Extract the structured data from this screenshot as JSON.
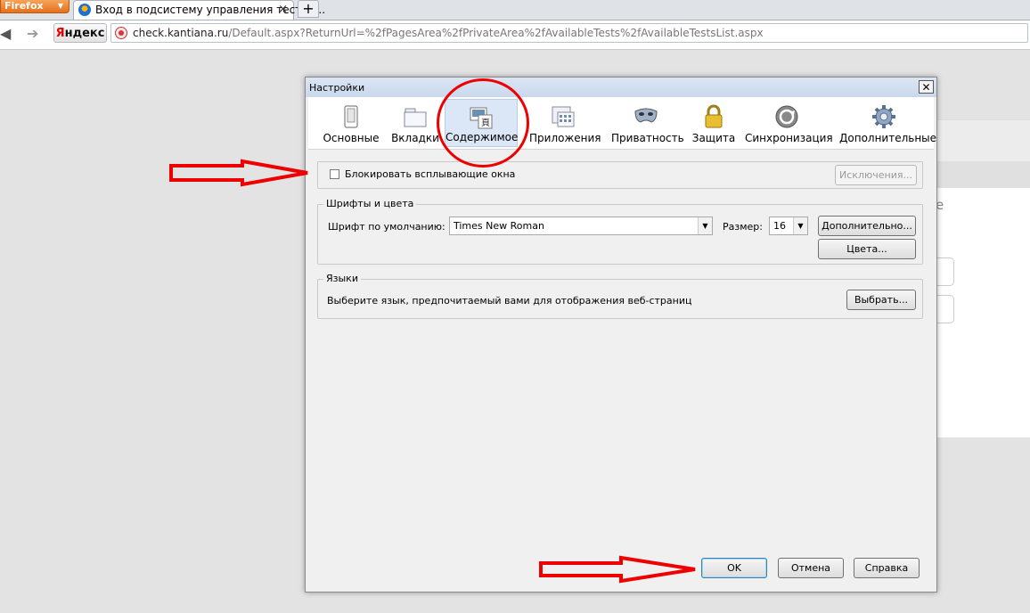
{
  "browser": {
    "menu_button": "Firefox",
    "tab_title": "Вход в подсистему управления тестир...",
    "tab_close": "×",
    "newtab": "+",
    "yandex_label_ya": "Я",
    "yandex_label_rest": "ндекс",
    "url_host": "check.kantiana.ru",
    "url_path": "/Default.aspx?ReturnUrl=%2fPagesArea%2fPrivateArea%2fAvailableTests%2fAvailableTestsList.aspx"
  },
  "page_behind": {
    "partial_letter": "e"
  },
  "dialog": {
    "title": "Настройки",
    "close": "✕",
    "tabs": [
      {
        "label": "Основные",
        "icon": "general-icon"
      },
      {
        "label": "Вкладки",
        "icon": "tabs-icon"
      },
      {
        "label": "Содержимое",
        "icon": "content-icon",
        "active": true
      },
      {
        "label": "Приложения",
        "icon": "applications-icon"
      },
      {
        "label": "Приватность",
        "icon": "privacy-mask-icon"
      },
      {
        "label": "Защита",
        "icon": "padlock-icon"
      },
      {
        "label": "Синхронизация",
        "icon": "sync-icon"
      },
      {
        "label": "Дополнительные",
        "icon": "gear-icon"
      }
    ],
    "popups": {
      "checkbox_label": "Блокировать всплывающие окна",
      "checked": false,
      "exceptions_button": "Исключения..."
    },
    "fonts": {
      "legend": "Шрифты и цвета",
      "default_font_label": "Шрифт по умолчанию:",
      "default_font_value": "Times New Roman",
      "size_label": "Размер:",
      "size_value": "16",
      "advanced_button": "Дополнительно...",
      "colors_button": "Цвета..."
    },
    "languages": {
      "legend": "Языки",
      "description": "Выберите язык, предпочитаемый вами для отображения веб-страниц",
      "choose_button": "Выбрать..."
    },
    "buttons": {
      "ok": "OK",
      "cancel": "Отмена",
      "help": "Справка"
    }
  },
  "colors": {
    "annotation_red": "#e00000",
    "active_tab_bg": "#dbe6f6",
    "firefox_orange": "#e5701b"
  }
}
